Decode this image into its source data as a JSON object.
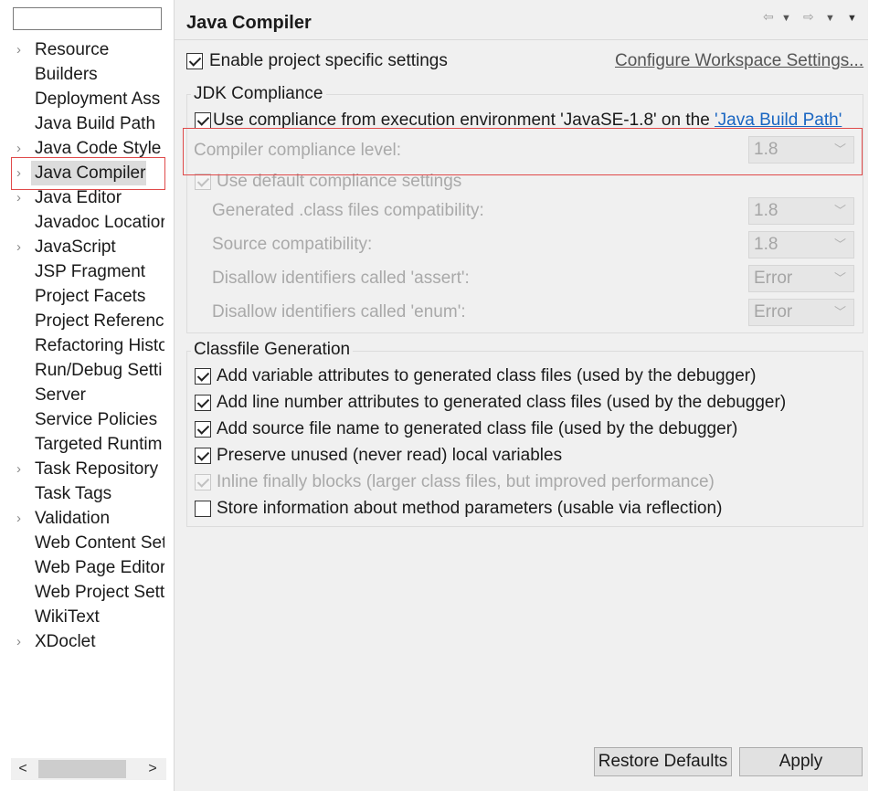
{
  "filter": {
    "value": ""
  },
  "tree": {
    "items": [
      {
        "label": "Resource",
        "expandable": true
      },
      {
        "label": "Builders",
        "expandable": false
      },
      {
        "label": "Deployment Ass",
        "expandable": false
      },
      {
        "label": "Java Build Path",
        "expandable": false
      },
      {
        "label": "Java Code Style",
        "expandable": true
      },
      {
        "label": "Java Compiler",
        "expandable": true,
        "selected": true
      },
      {
        "label": "Java Editor",
        "expandable": true
      },
      {
        "label": "Javadoc Locatior",
        "expandable": false
      },
      {
        "label": "JavaScript",
        "expandable": true
      },
      {
        "label": "JSP Fragment",
        "expandable": false
      },
      {
        "label": "Project Facets",
        "expandable": false
      },
      {
        "label": "Project Referenc",
        "expandable": false
      },
      {
        "label": "Refactoring Histo",
        "expandable": false
      },
      {
        "label": "Run/Debug Setti",
        "expandable": false
      },
      {
        "label": "Server",
        "expandable": false
      },
      {
        "label": "Service Policies",
        "expandable": false
      },
      {
        "label": "Targeted Runtim",
        "expandable": false
      },
      {
        "label": "Task Repository",
        "expandable": true
      },
      {
        "label": "Task Tags",
        "expandable": false
      },
      {
        "label": "Validation",
        "expandable": true
      },
      {
        "label": "Web Content Set",
        "expandable": false
      },
      {
        "label": "Web Page Editor",
        "expandable": false
      },
      {
        "label": "Web Project Sett",
        "expandable": false
      },
      {
        "label": "WikiText",
        "expandable": false
      },
      {
        "label": "XDoclet",
        "expandable": true
      }
    ],
    "scroll_left": "<",
    "scroll_right": ">"
  },
  "page": {
    "title": "Java Compiler",
    "nav": {
      "back": "⇦",
      "back_menu": "▼",
      "forward": "⇨",
      "forward_menu": "▼",
      "view_menu": "▼"
    },
    "enable_specific": {
      "label": "Enable project specific settings",
      "checked": true
    },
    "configure_link": "Configure Workspace Settings...",
    "jdk": {
      "title": "JDK Compliance",
      "use_env": {
        "prefix": "Use compliance from execution environment 'JavaSE-1.8' on the ",
        "link": "'Java Build Path'",
        "checked": true
      },
      "compliance_level": {
        "label": "Compiler compliance level:",
        "value": "1.8"
      },
      "use_default": {
        "label": "Use default compliance settings",
        "checked": true
      },
      "generated": {
        "label": "Generated .class files compatibility:",
        "value": "1.8"
      },
      "source": {
        "label": "Source compatibility:",
        "value": "1.8"
      },
      "assert": {
        "label": "Disallow identifiers called 'assert':",
        "value": "Error"
      },
      "enum": {
        "label": "Disallow identifiers called 'enum':",
        "value": "Error"
      }
    },
    "classfile": {
      "title": "Classfile Generation",
      "options": [
        {
          "label": "Add variable attributes to generated class files (used by the debugger)",
          "checked": true,
          "disabled": false
        },
        {
          "label": "Add line number attributes to generated class files (used by the debugger)",
          "checked": true,
          "disabled": false
        },
        {
          "label": "Add source file name to generated class file (used by the debugger)",
          "checked": true,
          "disabled": false
        },
        {
          "label": "Preserve unused (never read) local variables",
          "checked": true,
          "disabled": false
        },
        {
          "label": "Inline finally blocks (larger class files, but improved performance)",
          "checked": true,
          "disabled": true
        },
        {
          "label": "Store information about method parameters (usable via reflection)",
          "checked": false,
          "disabled": false
        }
      ]
    },
    "buttons": {
      "restore": "Restore Defaults",
      "apply": "Apply"
    }
  },
  "colors": {
    "highlight_box": "#e04a4a",
    "link": "#1a66c2",
    "selection": "#dcdcdc"
  }
}
